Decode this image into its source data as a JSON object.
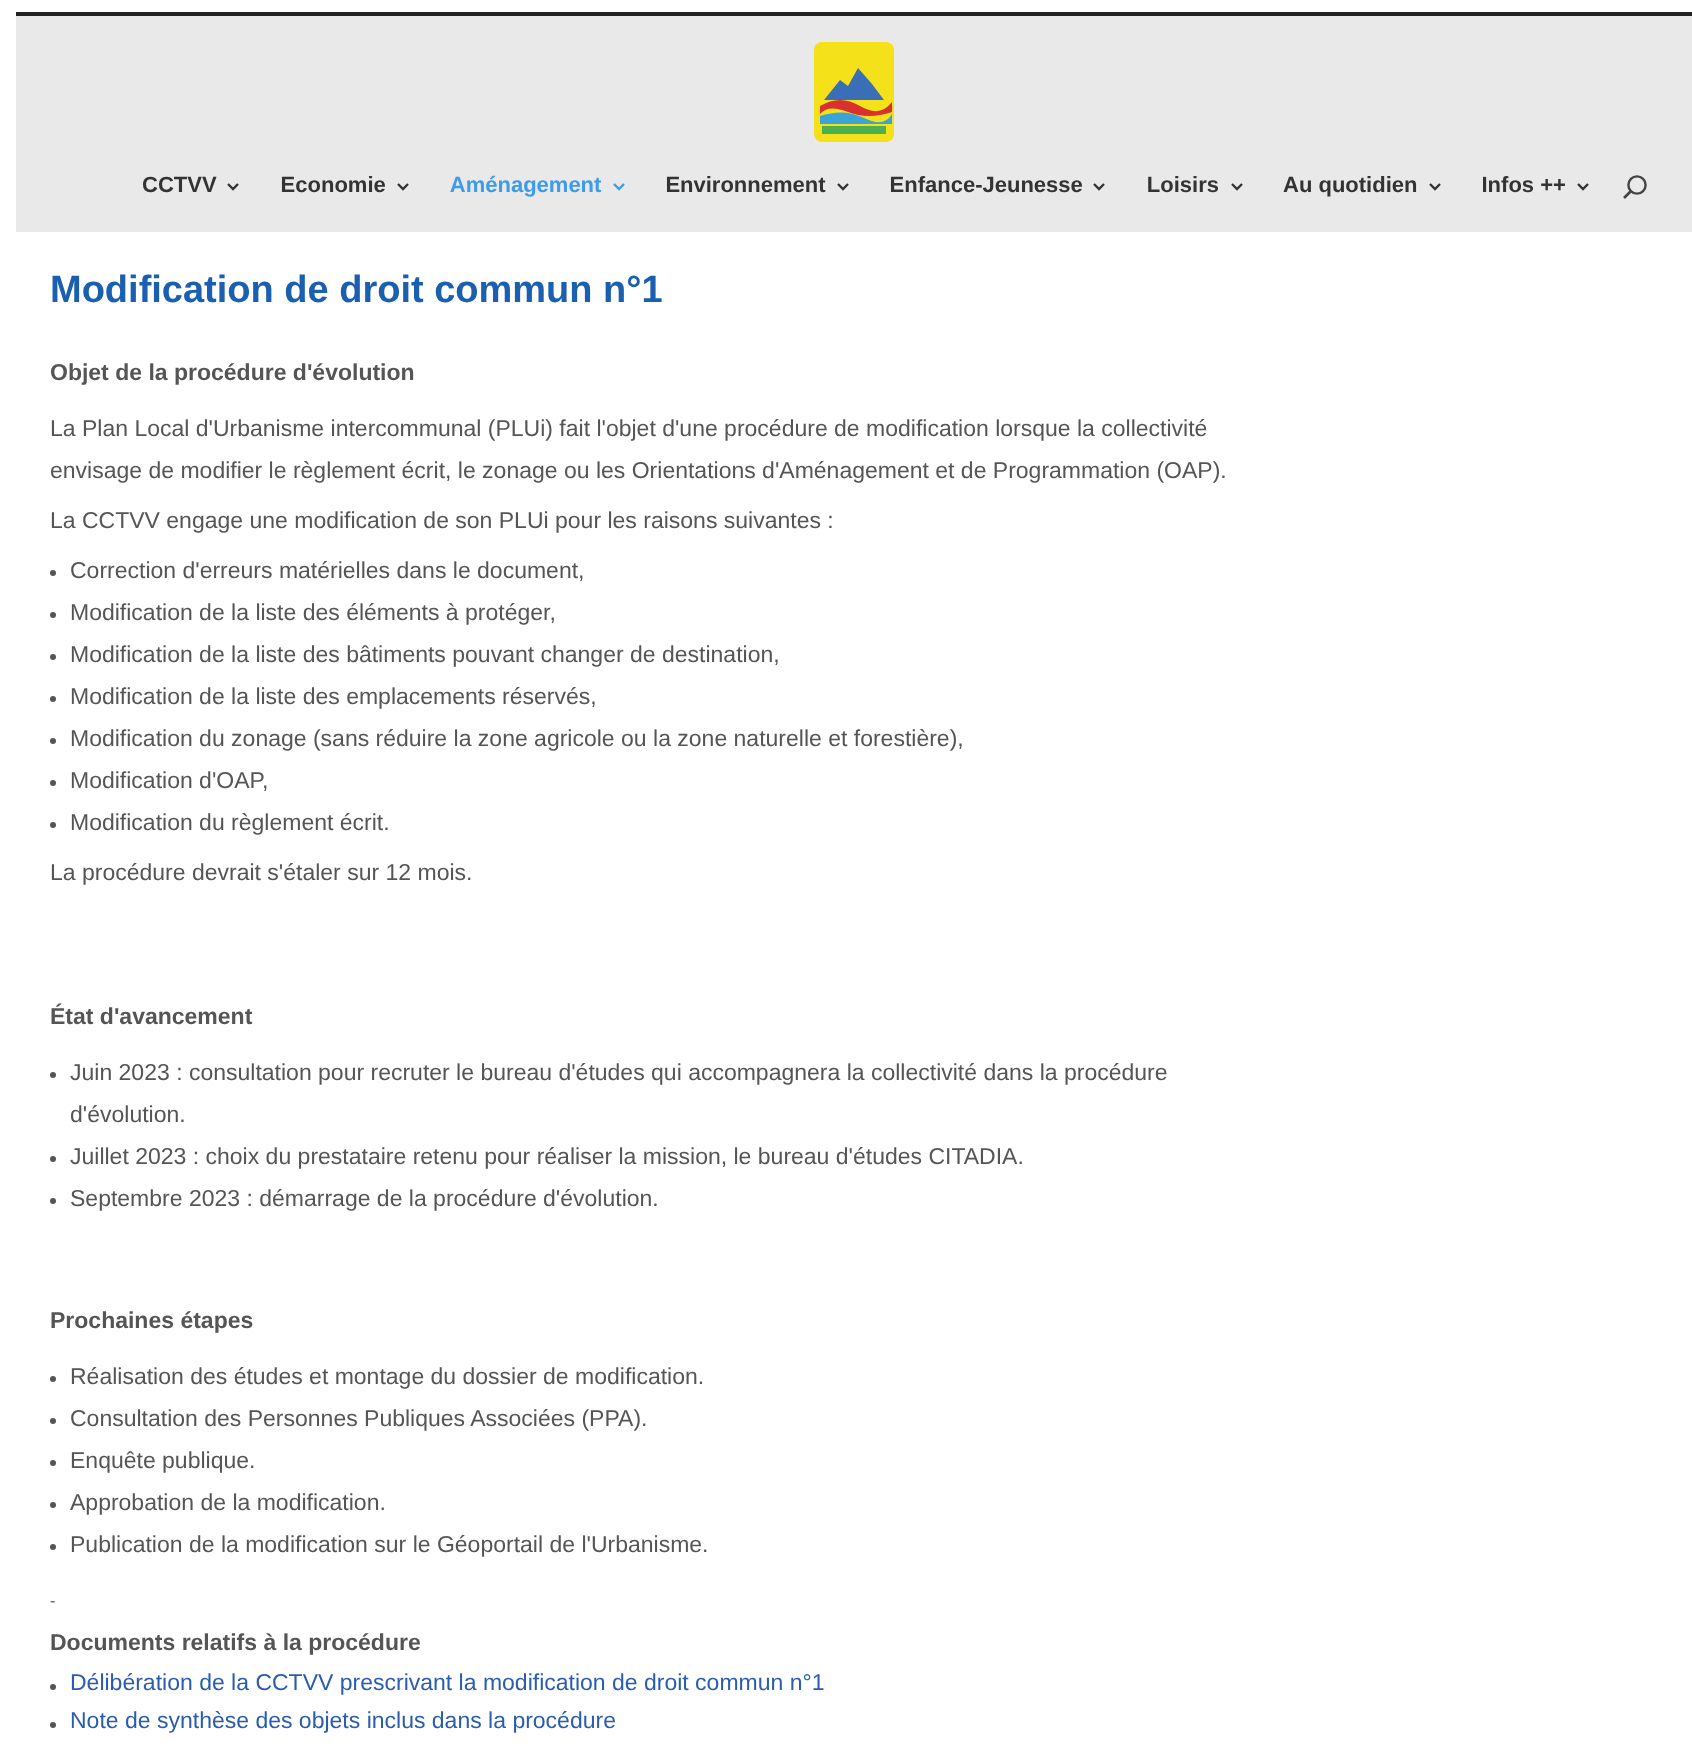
{
  "nav": {
    "items": [
      {
        "label": "CCTVV",
        "selected": false
      },
      {
        "label": "Economie",
        "selected": false
      },
      {
        "label": "Aménagement",
        "selected": true
      },
      {
        "label": "Environnement",
        "selected": false
      },
      {
        "label": "Enfance-Jeunesse",
        "selected": false
      },
      {
        "label": "Loisirs",
        "selected": false
      },
      {
        "label": "Au quotidien",
        "selected": false
      },
      {
        "label": "Infos ++",
        "selected": false
      }
    ]
  },
  "title": "Modification de droit commun n°1",
  "sections": [
    {
      "heading": "Objet de la procédure d'évolution",
      "blocks": [
        {
          "kind": "paragraph",
          "text": "La Plan Local d'Urbanisme intercommunal (PLUi) fait l'objet d'une procédure de modification lorsque la collectivité envisage de modifier le règlement écrit, le zonage ou les Orientations d'Aménagement et de Programmation (OAP)."
        },
        {
          "kind": "paragraph",
          "text": "La CCTVV engage une modification de son PLUi pour les raisons suivantes :"
        },
        {
          "kind": "list",
          "items": [
            "Correction d'erreurs matérielles dans le document,",
            "Modification de la liste des éléments à protéger,",
            "Modification de la liste des bâtiments pouvant changer de destination,",
            "Modification de la liste des emplacements réservés,",
            "Modification du zonage (sans réduire la zone agricole ou la zone naturelle et forestière),",
            "Modification d'OAP,",
            "Modification du règlement écrit."
          ]
        },
        {
          "kind": "paragraph",
          "text": "La procédure devrait s'étaler sur 12 mois."
        }
      ]
    },
    {
      "heading": "État d'avancement",
      "blocks": [
        {
          "kind": "list",
          "items": [
            "Juin 2023 : consultation pour recruter le bureau d'études qui accompagnera la collectivité dans la procédure d'évolution.",
            "Juillet 2023 : choix du prestataire retenu pour réaliser la mission, le bureau d'études CITADIA.",
            "Septembre 2023 : démarrage de la procédure d'évolution."
          ]
        }
      ]
    },
    {
      "heading": "Prochaines étapes",
      "blocks": [
        {
          "kind": "list",
          "items": [
            "Réalisation des études et montage du dossier de modification.",
            "Consultation des Personnes Publiques Associées (PPA).",
            "Enquête publique.",
            "Approbation de la modification.",
            "Publication de la modification sur le Géoportail de l'Urbanisme."
          ]
        },
        {
          "kind": "mark",
          "text": "-"
        }
      ]
    },
    {
      "heading": "Documents relatifs à la procédure",
      "blocks": [
        {
          "kind": "links",
          "items": [
            "Délibération de la CCTVV prescrivant la modification de droit commun n°1",
            "Note de synthèse des objets inclus dans la procédure"
          ]
        }
      ]
    }
  ]
}
